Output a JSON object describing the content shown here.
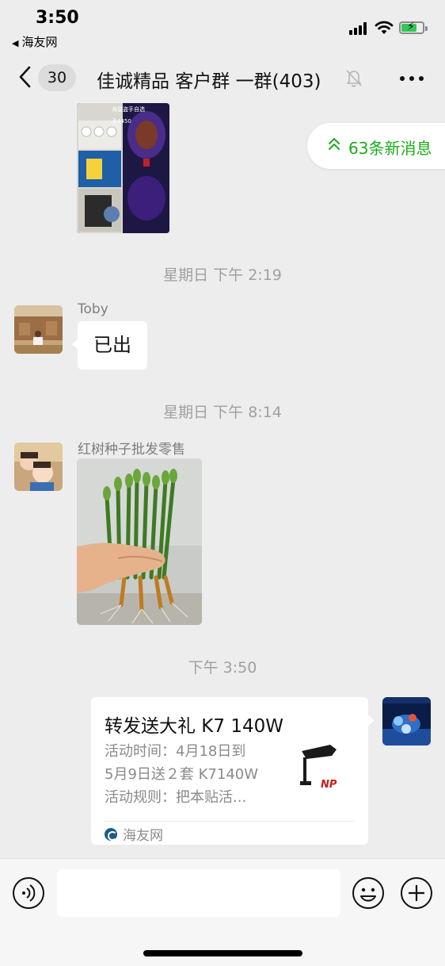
{
  "status_bar": {
    "time": "3:50",
    "back_app": "海友网"
  },
  "nav": {
    "unread_count": "30",
    "title": "佳诚精品 客户群 一群(403)"
  },
  "new_messages": {
    "label": "63条新消息"
  },
  "messages": [
    {
      "type": "image",
      "sender": "",
      "image_text": [
        "海星盗手自选",
        "手4450"
      ]
    },
    {
      "type": "timestamp",
      "text": "星期日 下午 2:19"
    },
    {
      "type": "text",
      "sender": "Toby",
      "text": "已出"
    },
    {
      "type": "timestamp",
      "text": "星期日 下午 8:14"
    },
    {
      "type": "image",
      "sender": "红树种子批发零售"
    },
    {
      "type": "timestamp",
      "text": "下午 3:50"
    },
    {
      "type": "link",
      "title": "转发送大礼 K7 140W",
      "desc_lines": [
        "活动时间：4月18日到",
        "5月9日送２套 K7140W",
        "活动规则：把本贴活..."
      ],
      "thumb_text": "NP",
      "source": "海友网"
    }
  ],
  "input": {
    "value": "",
    "placeholder": ""
  },
  "colors": {
    "background": "#ededed",
    "accent_green": "#1aad19",
    "bubble": "#ffffff",
    "timestamp": "#a0a0a0"
  },
  "icons": [
    "back-icon",
    "mute-icon",
    "more-icon",
    "double-chevron-up-icon",
    "voice-icon",
    "emoji-icon",
    "plus-icon",
    "signal-icon",
    "wifi-icon",
    "battery-icon"
  ]
}
